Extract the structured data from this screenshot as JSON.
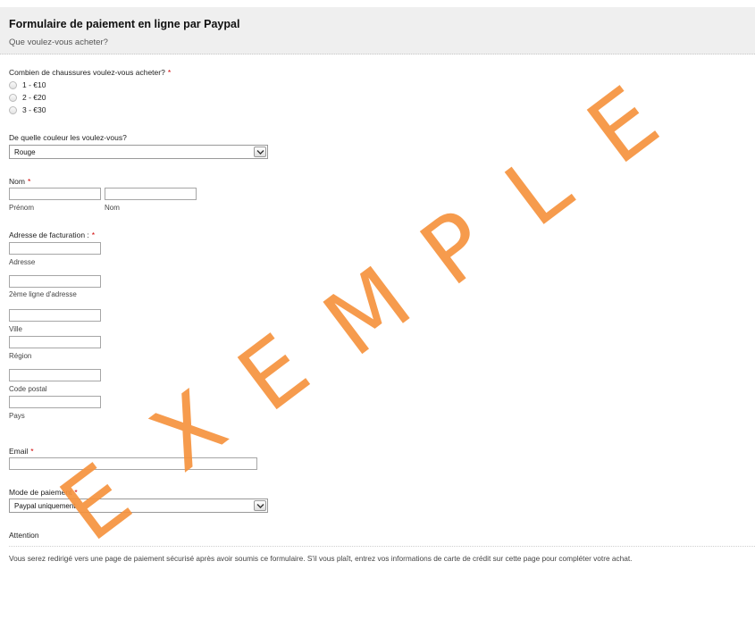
{
  "header": {
    "title": "Formulaire de paiement en ligne par Paypal",
    "subtitle": "Que voulez-vous acheter?"
  },
  "quantity": {
    "label": "Combien de chaussures voulez-vous acheter?",
    "required_mark": "*",
    "options": [
      "1 - €10",
      "2 - €20",
      "3 - €30"
    ]
  },
  "color": {
    "label": "De quelle couleur les voulez-vous?",
    "selected": "Rouge"
  },
  "name": {
    "label": "Nom",
    "required_mark": "*",
    "first_sublabel": "Prénom",
    "last_sublabel": "Nom"
  },
  "address": {
    "label": "Adresse de facturation :",
    "required_mark": "*",
    "street_sublabel": "Adresse",
    "line2_sublabel": "2ème ligne d'adresse",
    "city_sublabel": "Ville",
    "region_sublabel": "Région",
    "zip_sublabel": "Code postal",
    "country_sublabel": "Pays"
  },
  "email": {
    "label": "Email",
    "required_mark": "*"
  },
  "payment": {
    "label": "Mode de paiement",
    "required_mark": "*",
    "selected": "Paypal uniquement"
  },
  "attention": {
    "label": "Attention",
    "note": "Vous serez redirigé vers une page de paiement sécurisé après avoir soumis ce formulaire. S'il vous plaît, entrez vos informations de carte de crédit sur cette page pour compléter votre achat."
  },
  "watermark": {
    "letters": [
      "E",
      "X",
      "E",
      "M",
      "P",
      "L",
      "E"
    ],
    "color": "#f5923e"
  },
  "colors": {
    "required": "#d00000",
    "header_bg": "#efefef"
  },
  "icons": {
    "dropdown": "chevron-down-icon"
  }
}
